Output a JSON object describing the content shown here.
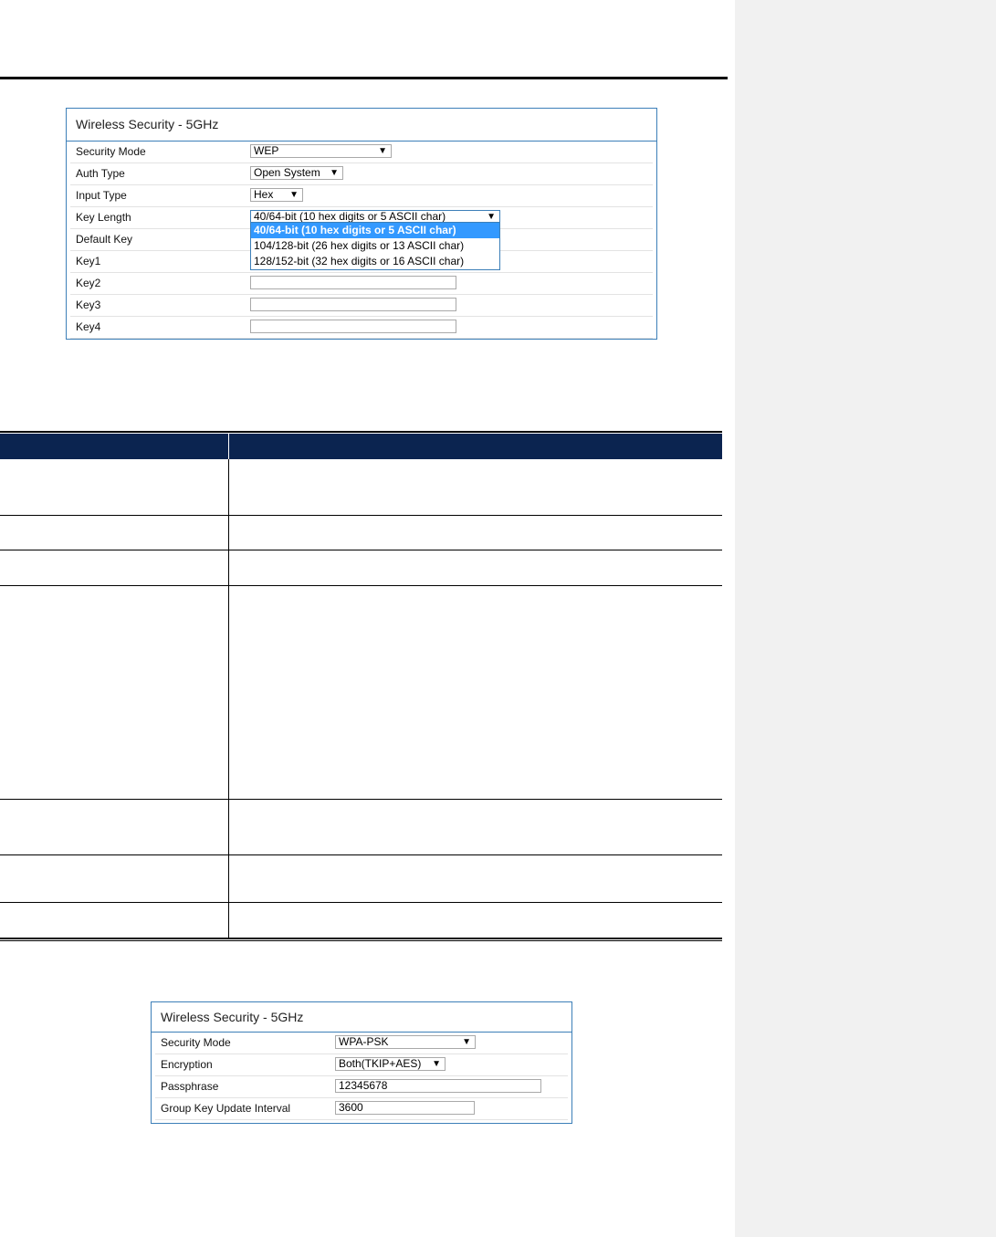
{
  "panel1": {
    "title": "Wireless Security - 5GHz",
    "rows": [
      {
        "label": "Security Mode",
        "value": "WEP"
      },
      {
        "label": "Auth Type",
        "value": "Open System"
      },
      {
        "label": "Input Type",
        "value": "Hex"
      },
      {
        "label": "Key Length",
        "value": "40/64-bit (10 hex digits or 5 ASCII char)"
      },
      {
        "label": "Default Key",
        "value": ""
      },
      {
        "label": "Key1",
        "value": ""
      },
      {
        "label": "Key2",
        "value": ""
      },
      {
        "label": "Key3",
        "value": ""
      },
      {
        "label": "Key4",
        "value": ""
      }
    ],
    "key_length_options": [
      "40/64-bit (10 hex digits or 5 ASCII char)",
      "104/128-bit (26 hex digits or 13 ASCII char)",
      "128/152-bit (32 hex digits or 16 ASCII char)"
    ],
    "arrow": "▼"
  },
  "panel2": {
    "title": "Wireless Security - 5GHz",
    "rows": [
      {
        "label": "Security Mode",
        "value": "WPA-PSK"
      },
      {
        "label": "Encryption",
        "value": "Both(TKIP+AES)"
      },
      {
        "label": "Passphrase",
        "value": "12345678"
      },
      {
        "label": "Group Key Update Interval",
        "value": "3600"
      }
    ],
    "arrow": "▼"
  },
  "colors": {
    "panel_border": "#3c7fb8",
    "table_header": "#0b2450",
    "dropdown_highlight": "#3399ff",
    "side_margin": "#f1f1f1"
  }
}
